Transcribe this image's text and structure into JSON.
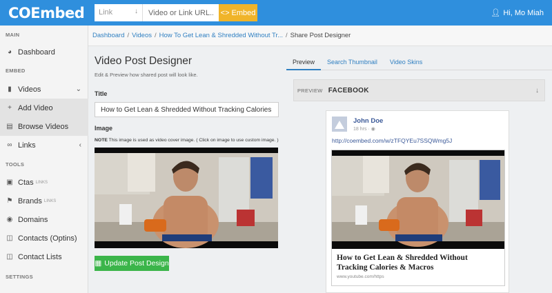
{
  "app": {
    "logo": "COEmbed"
  },
  "topbar": {
    "link_select": "Link",
    "url_placeholder": "Video or Link URL...",
    "embed_label": "Embed",
    "embed_icon": "code-icon",
    "user_label": "Hi, Mo Miah",
    "brand_color": "#2f8fdd",
    "embed_color": "#f0b429"
  },
  "sidebar": {
    "sections": {
      "main": "MAIN",
      "embed": "EMBED",
      "tools": "TOOLS",
      "settings": "SETTINGS"
    },
    "items": [
      {
        "label": "Dashboard",
        "icon": "dashboard-icon"
      },
      {
        "label": "Videos",
        "icon": "video-icon"
      },
      {
        "label": "Add Video",
        "icon": "plus-icon"
      },
      {
        "label": "Browse Videos",
        "icon": "list-icon"
      },
      {
        "label": "Links",
        "icon": "link-icon"
      },
      {
        "label": "Ctas",
        "sub": "LINKS",
        "icon": "cta-icon"
      },
      {
        "label": "Brands",
        "sub": "LINKS",
        "icon": "brand-icon"
      },
      {
        "label": "Domains",
        "icon": "globe-icon"
      },
      {
        "label": "Contacts (Optins)",
        "icon": "database-icon"
      },
      {
        "label": "Contact Lists",
        "icon": "database-icon"
      }
    ]
  },
  "breadcrumb": {
    "items": [
      "Dashboard",
      "Videos",
      "How To Get Lean & Shredded Without Tr..."
    ],
    "current": "Share Post Designer",
    "separator": "/"
  },
  "designer": {
    "title": "Video Post Designer",
    "subtitle": "Edit & Preview how shared post will look like.",
    "title_label": "Title",
    "title_value": "How to Get Lean & Shredded Without Tracking Calories & Mac",
    "image_label": "Image",
    "note_prefix": "NOTE",
    "note_text": "This image is used as video cover image. ( Click on image to use custom image. )",
    "update_button": "Update Post Design",
    "update_color": "#3bb54a"
  },
  "tabs": [
    "Preview",
    "Search Thumbnail",
    "Video Skins"
  ],
  "preview": {
    "label": "PREVIEW",
    "platform": "FACEBOOK"
  },
  "fb_post": {
    "author": "John Doe",
    "time": "18 hrs",
    "link": "http://coembed.com/w/zTFQYEu7SSQWmg5J",
    "headline": "How to Get Lean & Shredded Without Tracking Calories & Macros",
    "domain": "www.youtube.com/https"
  }
}
